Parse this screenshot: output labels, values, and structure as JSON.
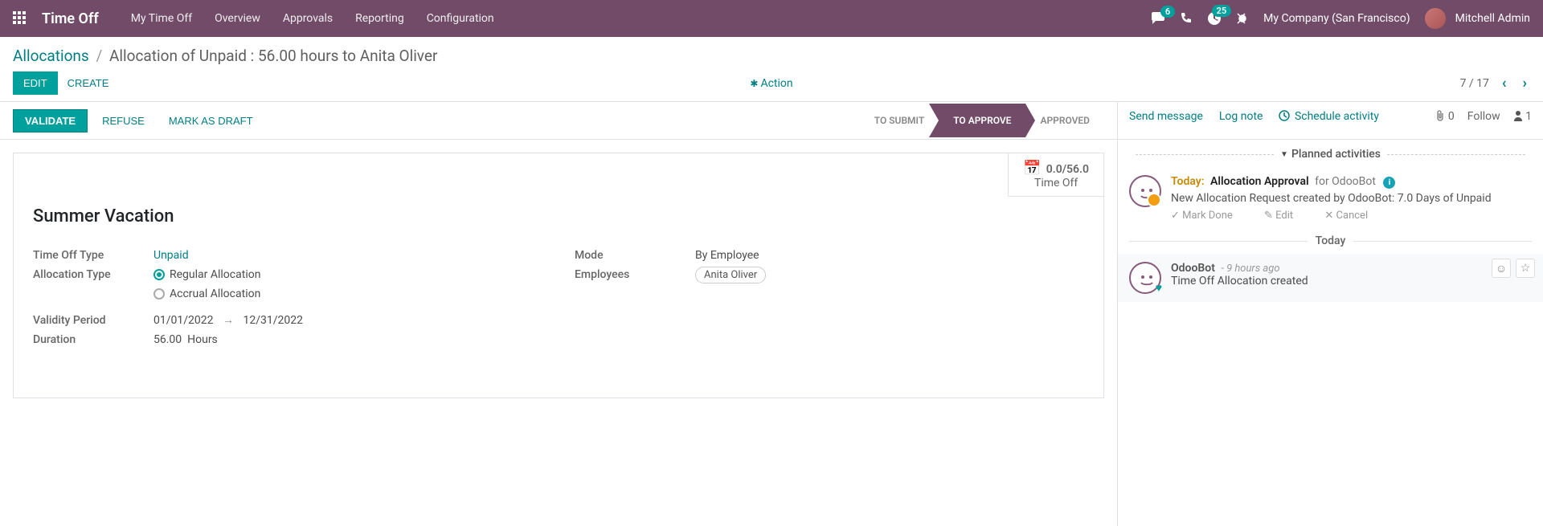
{
  "navbar": {
    "brand": "Time Off",
    "menu": [
      "My Time Off",
      "Overview",
      "Approvals",
      "Reporting",
      "Configuration"
    ],
    "messages_badge": "6",
    "activities_badge": "25",
    "company": "My Company (San Francisco)",
    "user": "Mitchell Admin"
  },
  "breadcrumb": {
    "parent": "Allocations",
    "current": "Allocation of Unpaid : 56.00 hours to Anita Oliver"
  },
  "buttons": {
    "edit": "EDIT",
    "create": "CREATE",
    "action": "Action",
    "validate": "VALIDATE",
    "refuse": "REFUSE",
    "draft": "MARK AS DRAFT"
  },
  "pager": "7 / 17",
  "status_steps": {
    "to_submit": "TO SUBMIT",
    "to_approve": "TO APPROVE",
    "approved": "APPROVED"
  },
  "stat": {
    "number": "0.0/56.0",
    "label": "Time Off"
  },
  "record": {
    "title": "Summer Vacation",
    "labels": {
      "type": "Time Off Type",
      "alloc_type": "Allocation Type",
      "validity": "Validity Period",
      "duration": "Duration",
      "mode": "Mode",
      "employees": "Employees"
    },
    "type": "Unpaid",
    "alloc_regular": "Regular Allocation",
    "alloc_accrual": "Accrual Allocation",
    "validity_from": "01/01/2022",
    "validity_to": "12/31/2022",
    "duration_val": "56.00",
    "duration_unit": "Hours",
    "mode": "By Employee",
    "employee_tag": "Anita Oliver"
  },
  "chatter": {
    "send": "Send message",
    "log": "Log note",
    "schedule": "Schedule activity",
    "attach_count": "0",
    "follow": "Follow",
    "follower_count": "1",
    "planned_title": "Planned activities",
    "activity": {
      "today": "Today:",
      "title": "Allocation Approval",
      "for": "for OdooBot",
      "desc": "New Allocation Request created by OdooBot: 7.0 Days of Unpaid",
      "mark_done": "Mark Done",
      "edit": "Edit",
      "cancel": "Cancel"
    },
    "day_label": "Today",
    "message": {
      "author": "OdooBot",
      "time": "- 9 hours ago",
      "body": "Time Off Allocation created"
    }
  }
}
